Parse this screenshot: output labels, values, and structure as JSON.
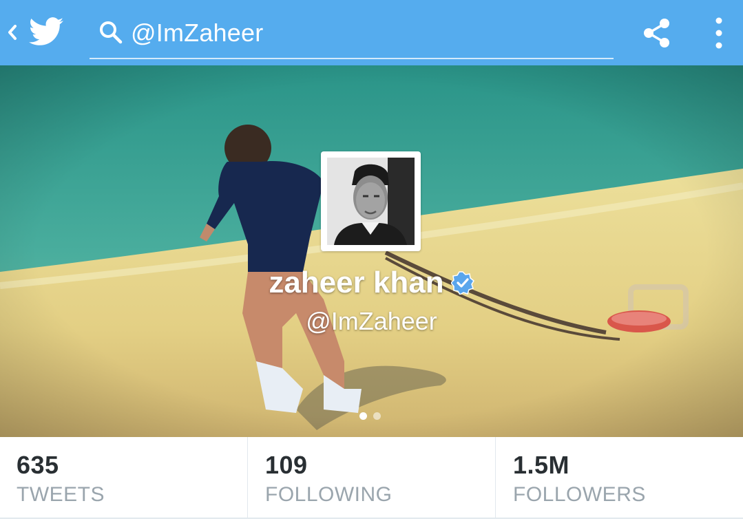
{
  "appbar": {
    "back_icon": "chevron-left-icon",
    "logo_icon": "twitter-bird-icon",
    "search_icon": "search-icon",
    "search_query": "@ImZaheer",
    "share_icon": "share-icon",
    "overflow_icon": "more-vertical-icon",
    "bar_color": "#55acee"
  },
  "profile": {
    "name": "zaheer khan",
    "handle": "@ImZaheer",
    "verified_icon": "verified-badge-icon",
    "verified_color": "#5aa6ec",
    "header_page": 1,
    "header_pages": 2
  },
  "stats": [
    {
      "value": "635",
      "label": "TWEETS"
    },
    {
      "value": "109",
      "label": "FOLLOWING"
    },
    {
      "value": "1.5M",
      "label": "FOLLOWERS"
    }
  ]
}
